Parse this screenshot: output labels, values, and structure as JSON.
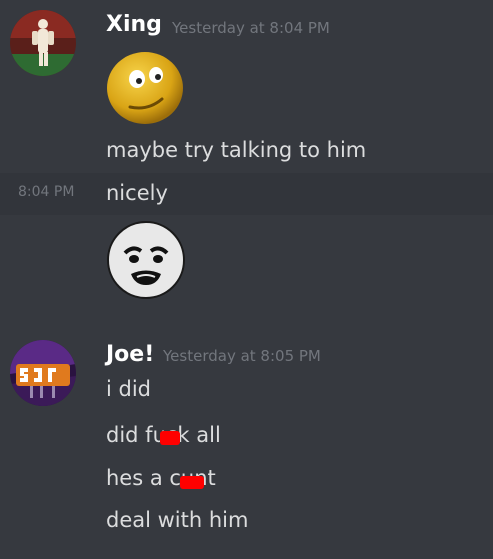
{
  "messages": [
    {
      "author": "Xing",
      "timestamp": "Yesterday at 8:04 PM",
      "avatar_icon": "white-figure-avatar",
      "items": [
        {
          "type": "emoji",
          "icon": "smirking-face-emoji"
        },
        {
          "type": "text",
          "text": "maybe try talking to him"
        },
        {
          "type": "text",
          "text": "nicely",
          "hover_time": "8:04 PM"
        },
        {
          "type": "emoji",
          "icon": "me-gusta-face-emoji"
        }
      ]
    },
    {
      "author": "Joe!",
      "timestamp": "Yesterday at 8:05 PM",
      "avatar_icon": "purple-logo-avatar",
      "items": [
        {
          "type": "text",
          "text": "i did"
        },
        {
          "type": "text",
          "text": "did fuck all"
        },
        {
          "type": "text",
          "text": "hes a cunt"
        },
        {
          "type": "text",
          "text": "deal with him"
        }
      ]
    }
  ],
  "colors": {
    "background": "#36393f",
    "hover_row": "#32353b",
    "name": "#ffffff",
    "text": "#dcddde",
    "timestamp": "#72767d",
    "censor": "#ff0000"
  }
}
